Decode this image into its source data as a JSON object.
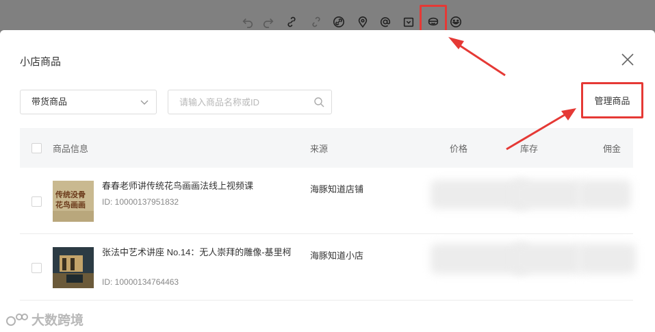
{
  "modal": {
    "title": "小店商品",
    "filter_select": "带货商品",
    "search_placeholder": "请输入商品名称或ID",
    "manage_button": "管理商品"
  },
  "table": {
    "headers": {
      "info": "商品信息",
      "source": "来源",
      "price": "价格",
      "stock": "库存",
      "commission": "佣金"
    },
    "rows": [
      {
        "name": "春春老师讲传统花鸟画画法线上视频课",
        "id": "ID: 10000137951832",
        "source": "海豚知道店铺",
        "thumb_text": "传统没骨花鸟画画"
      },
      {
        "name": "张法中艺术讲座 No.14：无人崇拜的雕像-基里柯",
        "id": "ID: 10000134764463",
        "source": "海豚知道小店"
      }
    ]
  },
  "watermark": "大数跨境"
}
